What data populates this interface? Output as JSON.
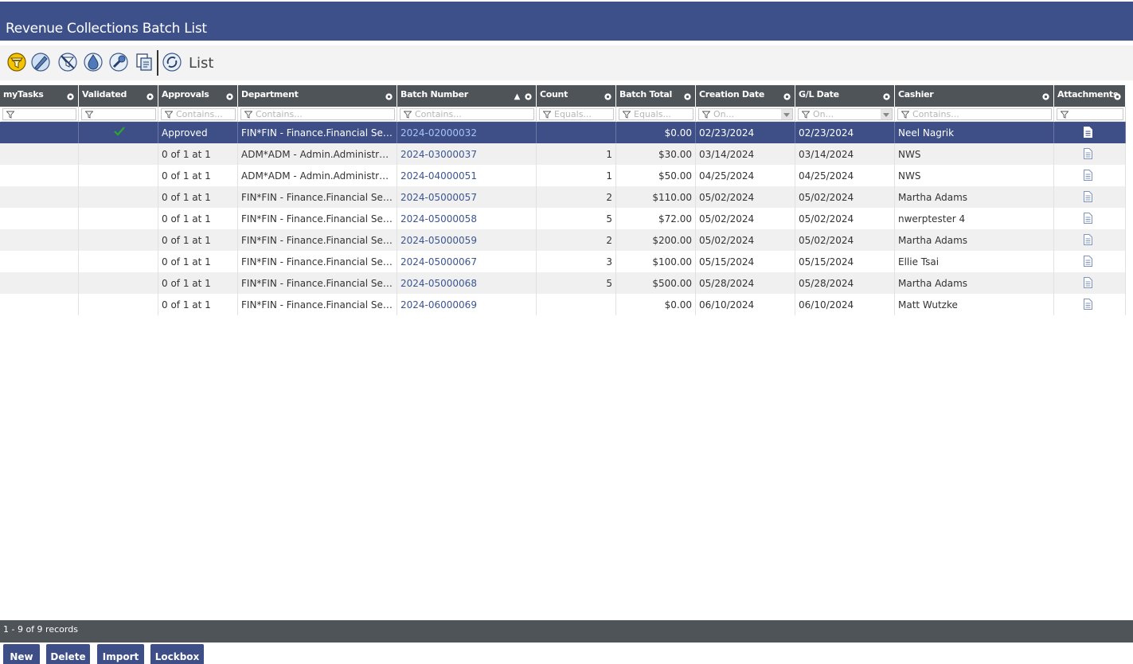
{
  "app": {
    "title": "Revenue Collections Batch List"
  },
  "toolbar": {
    "icons": [
      "filter-icon",
      "edit-icon",
      "clear-icon",
      "drop-icon",
      "tools-icon",
      "export-icon",
      "refresh-icon"
    ],
    "view_label": "List"
  },
  "columns": [
    {
      "label": "myTasks"
    },
    {
      "label": "Validated"
    },
    {
      "label": "Approvals"
    },
    {
      "label": "Department"
    },
    {
      "label": "Batch Number"
    },
    {
      "label": "Count"
    },
    {
      "label": "Batch Total"
    },
    {
      "label": "Creation Date"
    },
    {
      "label": "G/L Date"
    },
    {
      "label": "Cashier"
    },
    {
      "label": "Attachments"
    }
  ],
  "filters": {
    "approvals": "Contains...",
    "department": "Contains...",
    "batch_number": "Contains...",
    "count": "Equals...",
    "batch_total": "Equals...",
    "creation_date": "On...",
    "gl_date": "On...",
    "cashier": "Contains..."
  },
  "rows": [
    {
      "validated": true,
      "approvals": "Approved",
      "department": "FIN*FIN - Finance.Financial Services",
      "batch": "2024-02000032",
      "count": "",
      "total": "$0.00",
      "created": "02/23/2024",
      "gl": "02/23/2024",
      "cashier": "Neel Nagrik",
      "selected": true
    },
    {
      "validated": false,
      "approvals": "0 of 1 at 1",
      "department": "ADM*ADM - Admin.Administrative Services",
      "batch": "2024-03000037",
      "count": "1",
      "total": "$30.00",
      "created": "03/14/2024",
      "gl": "03/14/2024",
      "cashier": "NWS"
    },
    {
      "validated": false,
      "approvals": "0 of 1 at 1",
      "department": "ADM*ADM - Admin.Administrative Services",
      "batch": "2024-04000051",
      "count": "1",
      "total": "$50.00",
      "created": "04/25/2024",
      "gl": "04/25/2024",
      "cashier": "NWS"
    },
    {
      "validated": false,
      "approvals": "0 of 1 at 1",
      "department": "FIN*FIN - Finance.Financial Services",
      "batch": "2024-05000057",
      "count": "2",
      "total": "$110.00",
      "created": "05/02/2024",
      "gl": "05/02/2024",
      "cashier": "Martha Adams"
    },
    {
      "validated": false,
      "approvals": "0 of 1 at 1",
      "department": "FIN*FIN - Finance.Financial Services",
      "batch": "2024-05000058",
      "count": "5",
      "total": "$72.00",
      "created": "05/02/2024",
      "gl": "05/02/2024",
      "cashier": "nwerptester 4"
    },
    {
      "validated": false,
      "approvals": "0 of 1 at 1",
      "department": "FIN*FIN - Finance.Financial Services",
      "batch": "2024-05000059",
      "count": "2",
      "total": "$200.00",
      "created": "05/02/2024",
      "gl": "05/02/2024",
      "cashier": "Martha Adams"
    },
    {
      "validated": false,
      "approvals": "0 of 1 at 1",
      "department": "FIN*FIN - Finance.Financial Services",
      "batch": "2024-05000067",
      "count": "3",
      "total": "$100.00",
      "created": "05/15/2024",
      "gl": "05/15/2024",
      "cashier": "Ellie Tsai"
    },
    {
      "validated": false,
      "approvals": "0 of 1 at 1",
      "department": "FIN*FIN - Finance.Financial Services",
      "batch": "2024-05000068",
      "count": "5",
      "total": "$500.00",
      "created": "05/28/2024",
      "gl": "05/28/2024",
      "cashier": "Martha Adams"
    },
    {
      "validated": false,
      "approvals": "0 of 1 at 1",
      "department": "FIN*FIN - Finance.Financial Services",
      "batch": "2024-06000069",
      "count": "",
      "total": "$0.00",
      "created": "06/10/2024",
      "gl": "06/10/2024",
      "cashier": "Matt Wutzke"
    }
  ],
  "footer": {
    "records": "1 - 9 of 9 records"
  },
  "buttons": {
    "new": "New",
    "delete": "Delete",
    "import": "Import",
    "lockbox": "Lockbox"
  },
  "colors": {
    "header_blue": "#3d5089",
    "grid_header": "#4f5459",
    "selected_row": "#3d4f86",
    "link": "#3c5590",
    "check_green": "#2fa62f"
  }
}
